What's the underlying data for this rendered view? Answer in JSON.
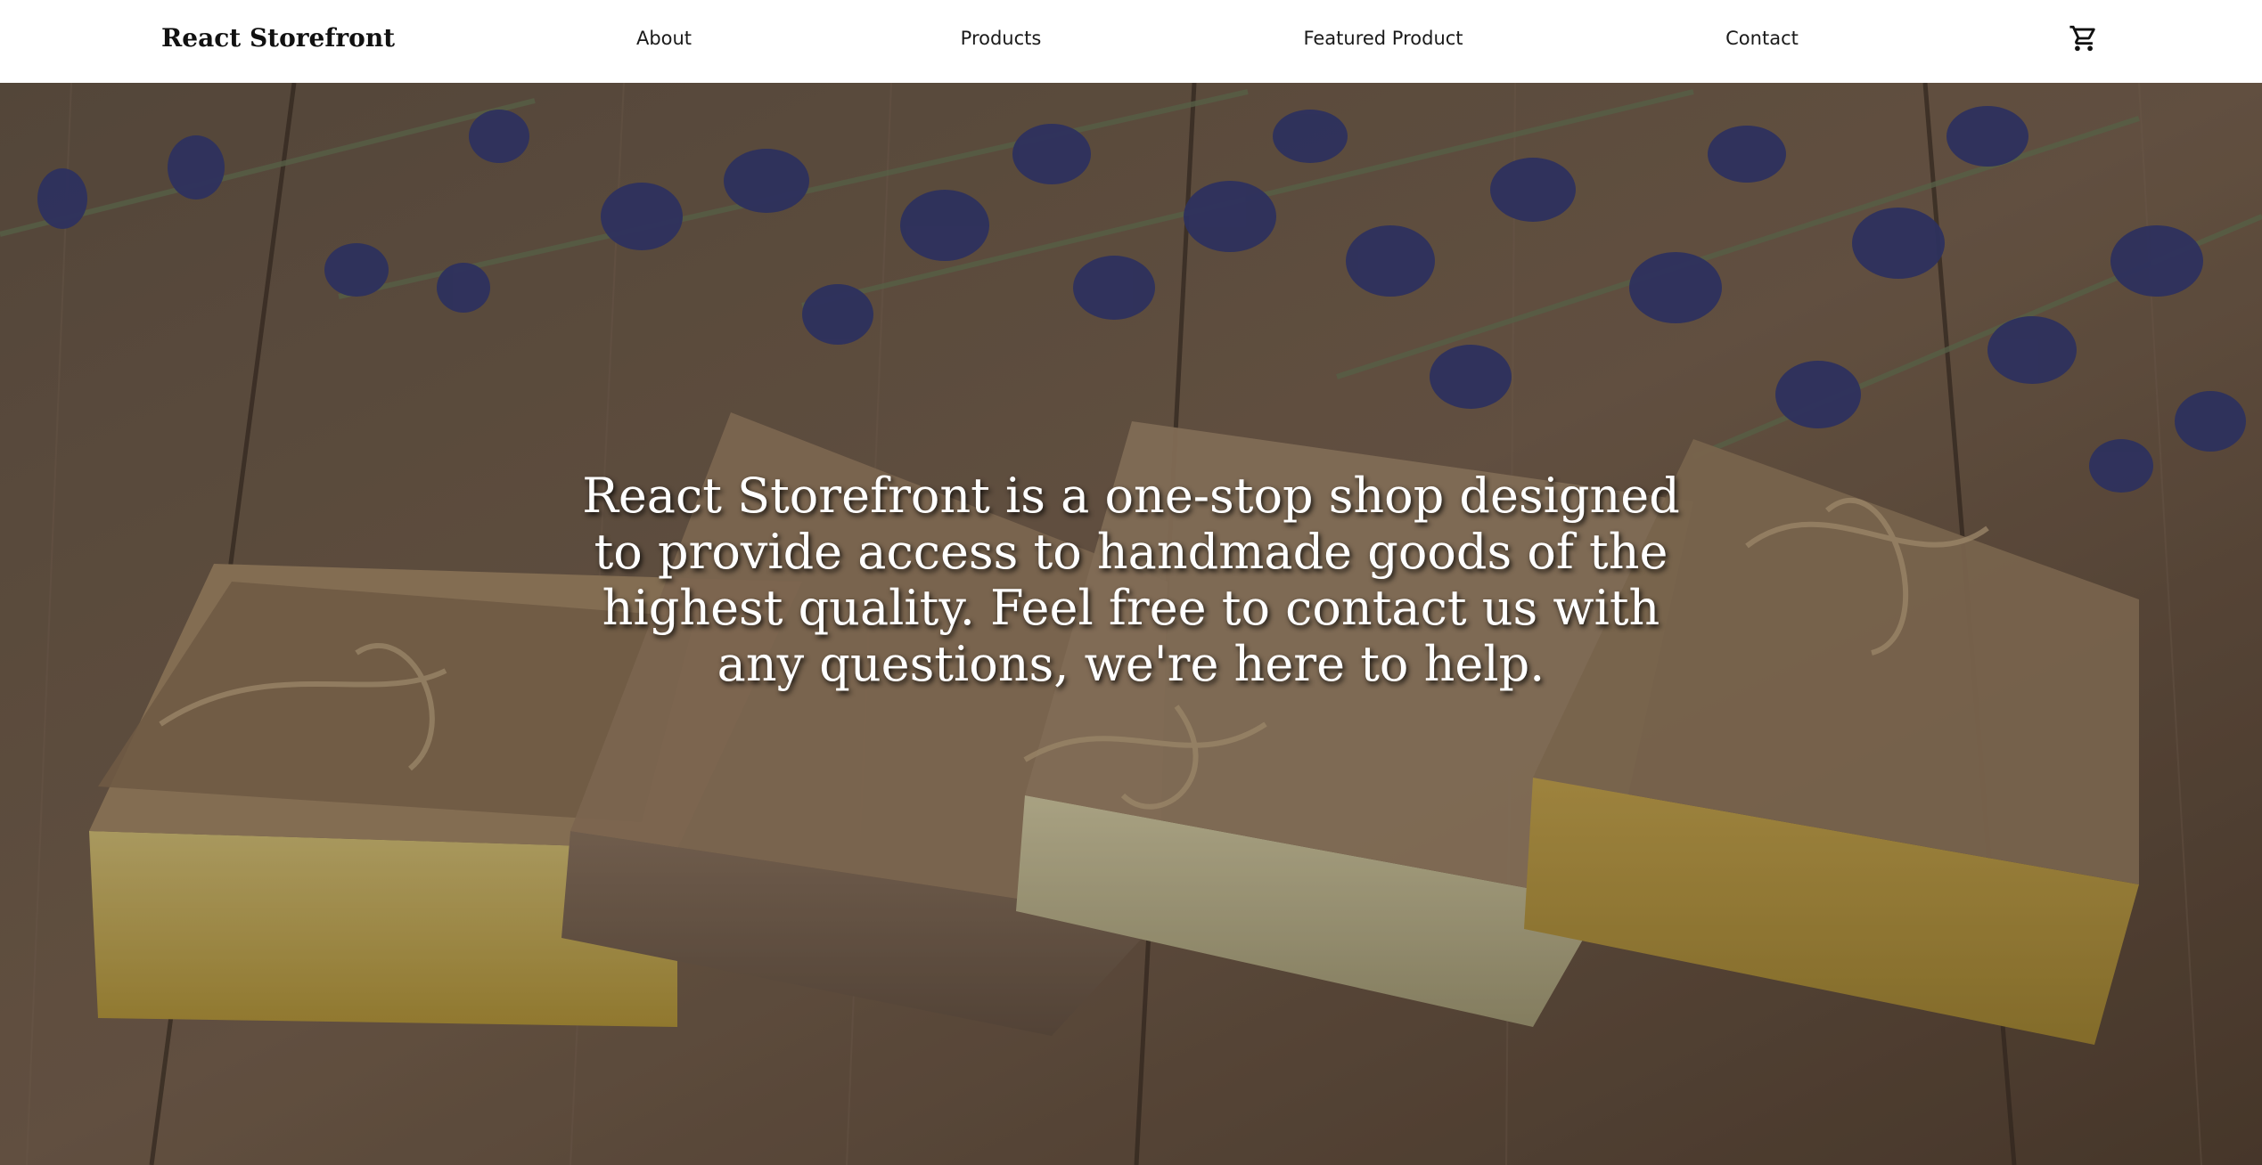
{
  "brand": {
    "name": "React Storefront"
  },
  "nav": {
    "about": "About",
    "products": "Products",
    "featured": "Featured Product",
    "contact": "Contact"
  },
  "cart": {
    "icon": "shopping-cart-icon"
  },
  "hero": {
    "tagline": "React Storefront is a one-stop shop designed to provide access to handmade goods of the highest quality. Feel free to contact us with any questions, we're here to help.",
    "background": "handmade soap bars wrapped in paper and twine with lavender on a wooden table"
  },
  "colors": {
    "nav_bg": "#ffffff",
    "nav_text": "#1a1a1a",
    "hero_text": "#ffffff"
  }
}
